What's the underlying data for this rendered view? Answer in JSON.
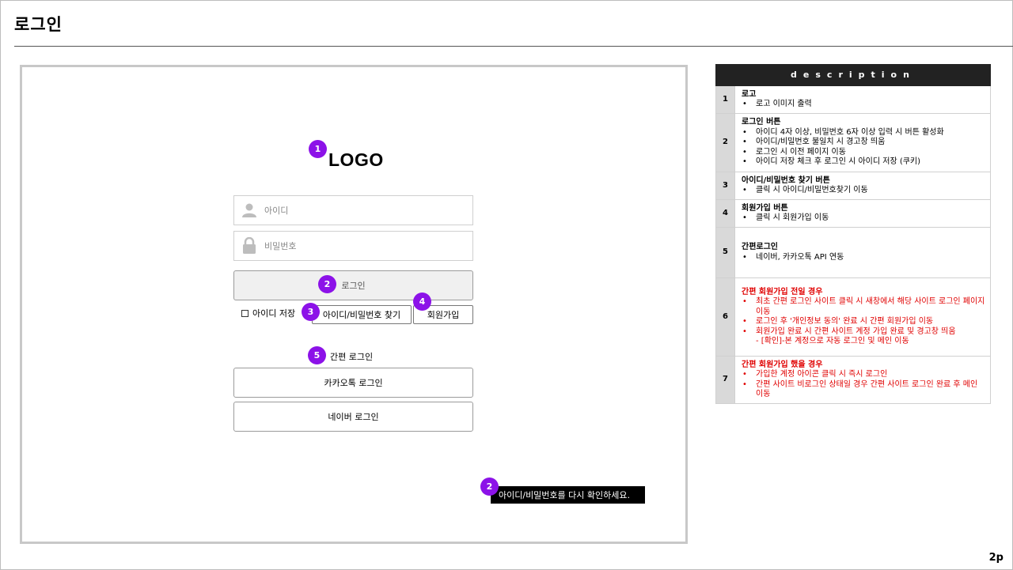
{
  "page": {
    "title": "로그인",
    "number": "2p"
  },
  "mock": {
    "logo": "LOGO",
    "id_placeholder": "아이디",
    "pw_placeholder": "비밀번호",
    "login_label": "로그인",
    "save_id_label": "아이디 저장",
    "find_label": "아이디/비밀번호 찾기",
    "join_label": "회원가입",
    "easy_login_label": "간편 로그인",
    "kakao_label": "카카오톡 로그인",
    "naver_label": "네이버 로그인",
    "toast": "아이디/비밀번호를 다시 확인하세요.",
    "markers": [
      "1",
      "2",
      "3",
      "4",
      "5",
      "2"
    ]
  },
  "description": {
    "header": "description",
    "rows": [
      {
        "num": "1",
        "title": "로고",
        "items": [
          "로고 이미지 출력"
        ]
      },
      {
        "num": "2",
        "title": "로그인 버튼",
        "items": [
          "아이디 4자 이상, 비밀번호 6자 이상 입력 시 버튼 활성화",
          "아이디/비밀번호 불일치 시 경고창 띄움",
          "로그인 시 이전 페이지 이동",
          "아이디 저장 체크 후 로그인 시 아이디 저장 (쿠키)"
        ]
      },
      {
        "num": "3",
        "title": "아이디/비밀번호 찾기 버튼",
        "items": [
          "클릭 시 아이디/비밀번호찾기 이동"
        ]
      },
      {
        "num": "4",
        "title": "회원가입 버튼",
        "items": [
          "클릭 시 회원가입 이동"
        ]
      },
      {
        "num": "5",
        "title": "간편로그인",
        "items": [
          "네이버, 카카오톡 API 연동"
        ]
      },
      {
        "num": "6",
        "title": "간편 회원가입 전일 경우",
        "items": [
          "최초 간편 로그인 사이트 클릭 시 새창에서 해당 사이트 로그인 페이지 이동",
          "로그인 후 '개인정보 동의' 완료 시 간편 회원가입 이동",
          "회원가입 완료 시 간편 사이트 계정 가입 완료 및 경고창 띄움"
        ],
        "sub": "- [확인]-본 계정으로 자동 로그인 및 메인 이동"
      },
      {
        "num": "7",
        "title": "간편 회원가입 했을 경우",
        "items": [
          "가입한 계정 아이콘 클릭 시 즉시 로그인",
          "간편 사이트 비로그인 상태일 경우 간편 사이트 로그인 완료 후 메인 이동"
        ]
      }
    ]
  },
  "colors": {
    "marker": "#8c12e8",
    "warning_text": "#e00000",
    "header_bg": "#222222"
  }
}
